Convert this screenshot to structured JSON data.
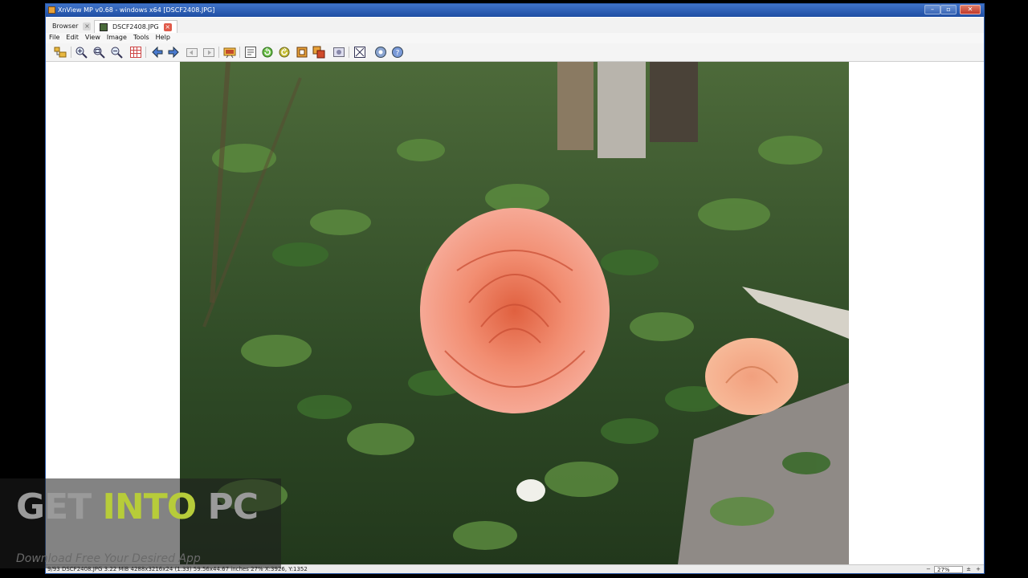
{
  "window": {
    "title": "XnView MP v0.68 - windows x64 [DSCF2408.JPG]",
    "controls": {
      "minimize": "–",
      "maximize": "▫",
      "close": "✕"
    }
  },
  "tabs": [
    {
      "label": "Browser",
      "close": "×"
    },
    {
      "label": "DSCF2408.JPG",
      "close": "×"
    }
  ],
  "menu": [
    "File",
    "Edit",
    "View",
    "Image",
    "Tools",
    "Help"
  ],
  "toolbar_icons": [
    "browser-icon",
    "zoom-in-icon",
    "zoom-fit-icon",
    "zoom-out-icon",
    "grid-icon",
    "previous-icon",
    "next-icon",
    "first-icon",
    "last-icon",
    "slideshow-icon",
    "properties-icon",
    "rotate-left-icon",
    "rotate-right-icon",
    "crop-icon",
    "resize-icon",
    "adjust-icon",
    "fullscreen-icon",
    "settings-icon",
    "help-icon"
  ],
  "status": {
    "text": "9/93  DSCF2408.JPG  3.22 MiB  4288x3216x24 (1.33)  59.56x44.67 inches  27%  X:3926, Y:1352",
    "zoom": "27%"
  },
  "watermark": {
    "part1": "GET ",
    "part2": "INTO",
    "part3": " PC",
    "subtitle": "Download Free Your Desired App"
  },
  "colors": {
    "titlebar": "#2c5db5",
    "watermark_accent": "#b7cc3a",
    "rose": "#f08870"
  }
}
